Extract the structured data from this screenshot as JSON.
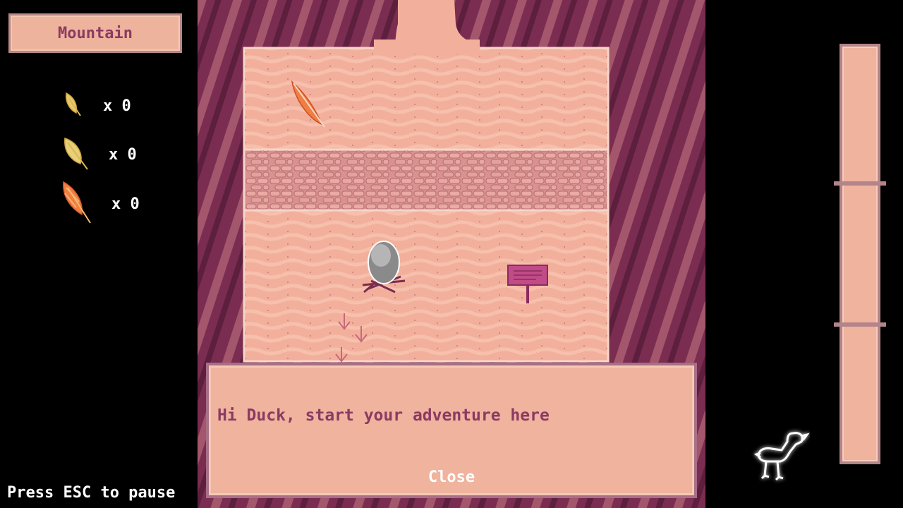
{
  "hud": {
    "area_name": "Mountain",
    "pause_hint": "Press ESC to pause",
    "counters": [
      {
        "icon": "small-yellow-feather-icon",
        "value": "x 0"
      },
      {
        "icon": "large-yellow-feather-icon",
        "value": "x 0"
      },
      {
        "icon": "orange-feather-icon",
        "value": "x 0"
      }
    ]
  },
  "dialog": {
    "message": "Hi Duck, start your adventure here",
    "close_label": "Close"
  },
  "colors": {
    "panel_fill": "#efb39e",
    "panel_border": "#a86f86",
    "text_accent": "#8b3a62",
    "ground": "#f2b39f",
    "cliff": "#7b2f52"
  }
}
